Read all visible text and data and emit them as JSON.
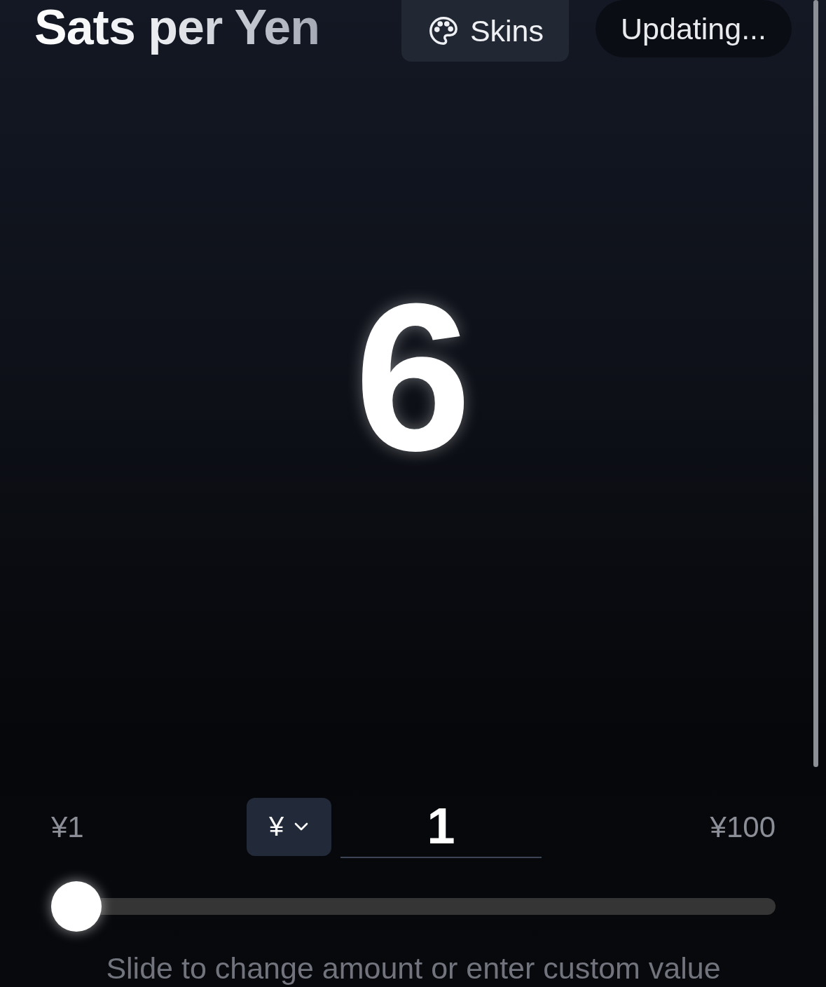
{
  "header": {
    "title": "Sats per Yen",
    "skins_button": {
      "label": "Skins"
    },
    "status": "Updating..."
  },
  "result": {
    "sats": "6"
  },
  "controls": {
    "min_label": "¥1",
    "currency": {
      "symbol": "¥"
    },
    "amount_input": {
      "value": "1"
    },
    "max_label": "¥100",
    "slider": {
      "level": 0
    },
    "hint": "Slide to change amount or enter custom value"
  }
}
